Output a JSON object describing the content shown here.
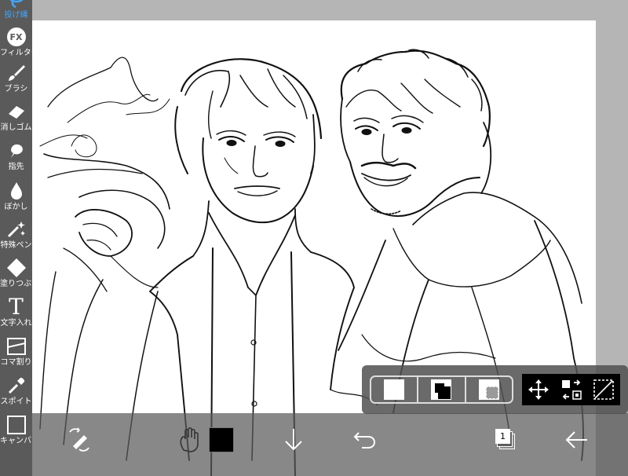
{
  "toolbar": {
    "items": [
      {
        "label": "投げ縄",
        "icon": "lasso-icon",
        "active": true
      },
      {
        "label": "フィルター",
        "icon": "fx-icon",
        "icon_text": "FX"
      },
      {
        "label": "ブラシ",
        "icon": "brush-icon"
      },
      {
        "label": "消しゴム",
        "icon": "eraser-icon"
      },
      {
        "label": "指先",
        "icon": "finger-icon"
      },
      {
        "label": "ぼかし",
        "icon": "blur-icon"
      },
      {
        "label": "特殊ペン",
        "icon": "special-pen-icon"
      },
      {
        "label": "塗りつぶし",
        "icon": "fill-icon"
      },
      {
        "label": "文字入れ",
        "icon": "text-icon",
        "icon_text": "T"
      },
      {
        "label": "コマ割り",
        "icon": "frame-divider-icon"
      },
      {
        "label": "スポイト",
        "icon": "eyedropper-icon"
      },
      {
        "label": "キャンバス",
        "icon": "canvas-icon"
      }
    ]
  },
  "bottom_bar": {
    "items": [
      "transform-icon",
      "hand-icon",
      "color-swatch",
      "download-icon",
      "undo-icon",
      "redo-icon",
      "layers-icon",
      "back-arrow-icon"
    ],
    "layer_count": "1",
    "current_color": "#000000",
    "redo_enabled": false
  },
  "selection_panel": {
    "modes": [
      "selection-clear-icon",
      "selection-invert-icon",
      "selection-deselect-icon"
    ],
    "tools": [
      "move-icon",
      "transform-select-icon",
      "select-all-icon"
    ]
  },
  "colors": {
    "accent": "#41a6ff",
    "toolbar_bg": "#5a5a5a",
    "canvas_bg": "#ffffff",
    "workspace_bg": "#b5b5b5"
  }
}
